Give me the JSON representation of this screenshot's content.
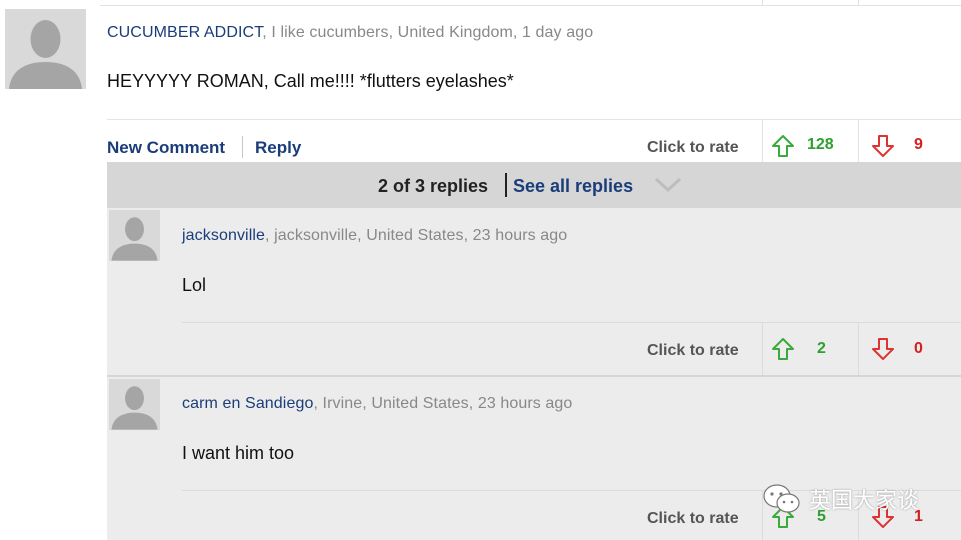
{
  "main_comment": {
    "username": "CUCUMBER ADDICT",
    "tagline": ", I like cucumbers, United Kingdom, 1 day ago",
    "text": "HEYYYYY ROMAN, Call me!!!! *flutters eyelashes*",
    "new_comment_label": "New Comment",
    "reply_label": "Reply",
    "rate_label": "Click to rate",
    "upvotes": "128",
    "downvotes": "9"
  },
  "replies_bar": {
    "count_text": "2 of 3 replies",
    "see_all_label": "See all replies"
  },
  "replies": [
    {
      "username": "jacksonville",
      "tagline": ", jacksonville, United States, 23 hours ago",
      "text": "Lol",
      "rate_label": "Click to rate",
      "upvotes": "2",
      "downvotes": "0"
    },
    {
      "username": "carm en Sandiego",
      "tagline": ", Irvine, United States, 23 hours ago",
      "text": "I want him too",
      "rate_label": "Click to rate",
      "upvotes": "5",
      "downvotes": "1"
    }
  ],
  "watermark": {
    "text": "英国大家谈"
  },
  "colors": {
    "link": "#1a3d7a",
    "upvote": "#2ea02e",
    "downvote": "#d42020",
    "reply_bg": "#ececec",
    "bar_bg": "#d6d6d6"
  },
  "icons": [
    "avatar-silhouette",
    "arrow-up-icon",
    "arrow-down-icon",
    "chevron-down-icon",
    "wechat-icon"
  ]
}
